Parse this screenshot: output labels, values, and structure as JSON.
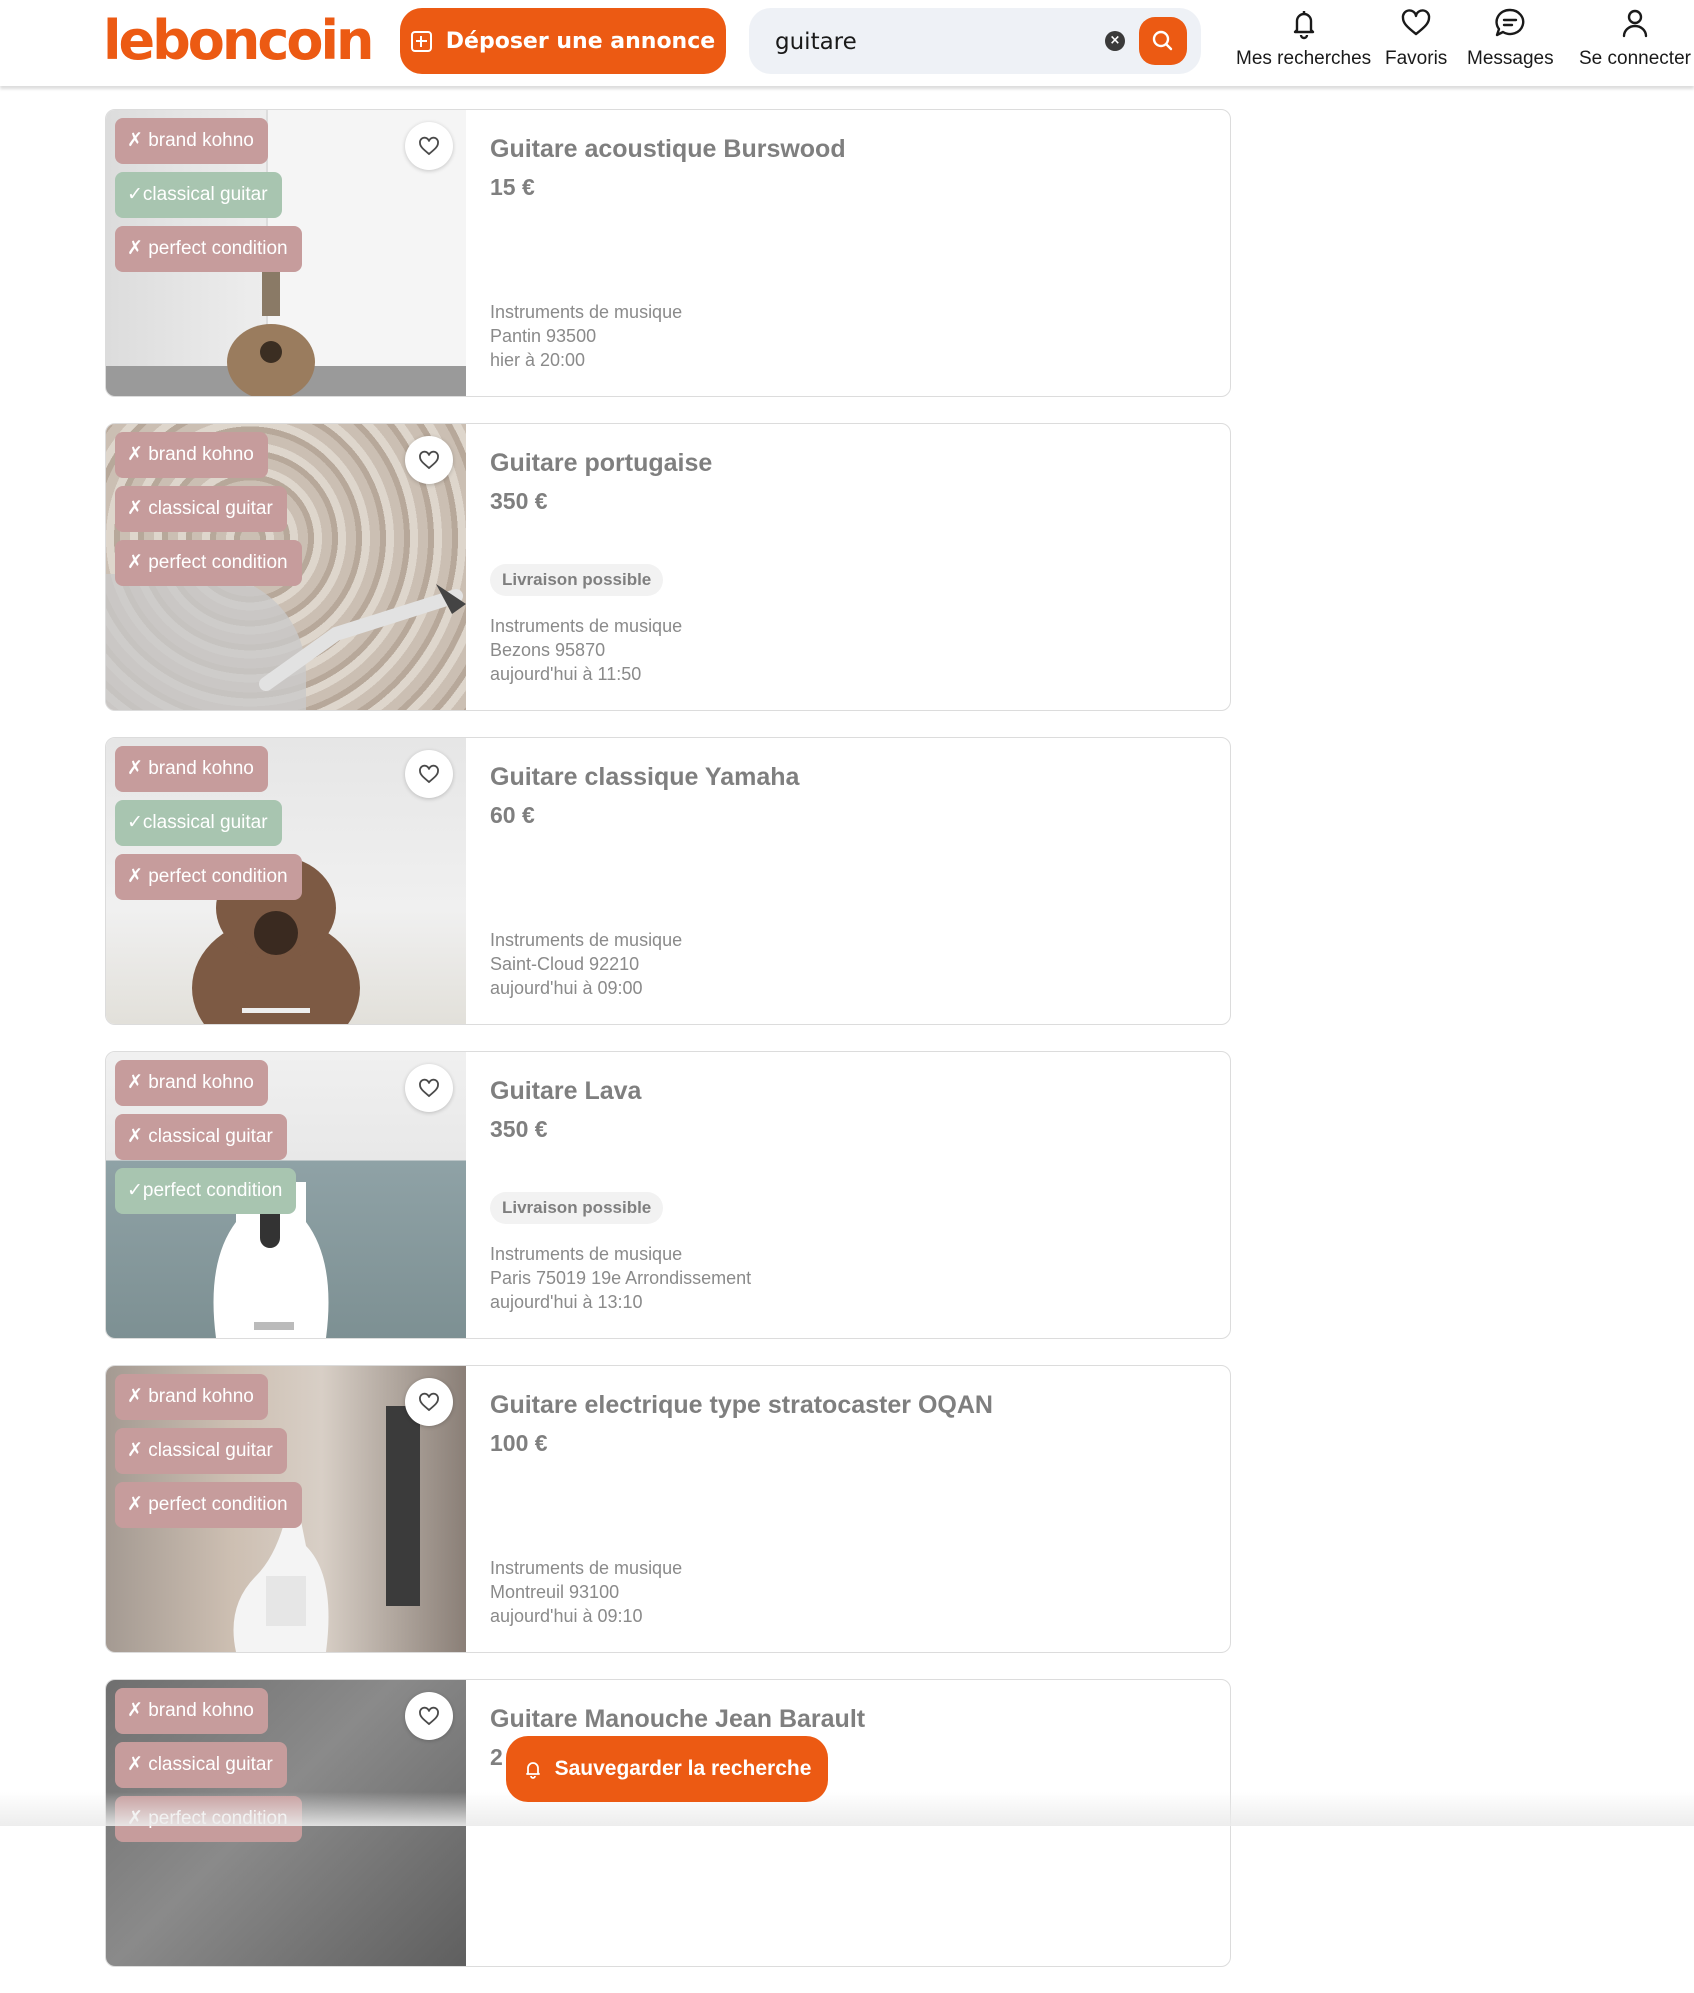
{
  "header": {
    "logo": "leboncoin",
    "deposit_label": "Déposer une annonce",
    "search_value": "guitare",
    "clear_label": "×",
    "nav": [
      {
        "label": "Mes recherches",
        "icon": "bell-icon"
      },
      {
        "label": "Favoris",
        "icon": "heart-icon"
      },
      {
        "label": "Messages",
        "icon": "chat-icon"
      },
      {
        "label": "Se connecter",
        "icon": "user-icon"
      }
    ]
  },
  "colors": {
    "brand": "#ec5a13",
    "tag_no": "#c69c9c",
    "tag_yes": "#a8c5b0"
  },
  "listings": [
    {
      "title": "Guitare acoustique Burswood",
      "price": "15 €",
      "badge": "",
      "category": "Instruments de musique",
      "location": "Pantin 93500",
      "date": "hier à 20:00",
      "tags": [
        "✗ brand kohno",
        "✓classical guitar",
        "✗ perfect condition"
      ]
    },
    {
      "title": "Guitare portugaise",
      "price": "350 €",
      "badge": "Livraison possible",
      "category": "Instruments de musique",
      "location": "Bezons 95870",
      "date": "aujourd'hui à 11:50",
      "tags": [
        "✗ brand kohno",
        "✗ classical guitar",
        "✗ perfect condition"
      ]
    },
    {
      "title": "Guitare classique Yamaha",
      "price": "60 €",
      "badge": "",
      "category": "Instruments de musique",
      "location": "Saint-Cloud 92210",
      "date": "aujourd'hui à 09:00",
      "tags": [
        "✗ brand kohno",
        "✓classical guitar",
        "✗ perfect condition"
      ]
    },
    {
      "title": "Guitare Lava",
      "price": "350 €",
      "badge": "Livraison possible",
      "category": "Instruments de musique",
      "location": "Paris 75019 19e Arrondissement",
      "date": "aujourd'hui à 13:10",
      "tags": [
        "✗ brand kohno",
        "✗ classical guitar",
        "✓perfect condition"
      ]
    },
    {
      "title": "Guitare electrique type stratocaster OQAN",
      "price": "100 €",
      "badge": "",
      "category": "Instruments de musique",
      "location": "Montreuil 93100",
      "date": "aujourd'hui à 09:10",
      "tags": [
        "✗ brand kohno",
        "✗ classical guitar",
        "✗ perfect condition"
      ]
    },
    {
      "title": "Guitare Manouche Jean Barault",
      "price": "2",
      "badge": "",
      "category": "",
      "location": "",
      "date": "",
      "tags": [
        "✗ brand kohno",
        "✗ classical guitar",
        "✗ perfect condition"
      ]
    }
  ],
  "save_search_label": "Sauvegarder la recherche"
}
